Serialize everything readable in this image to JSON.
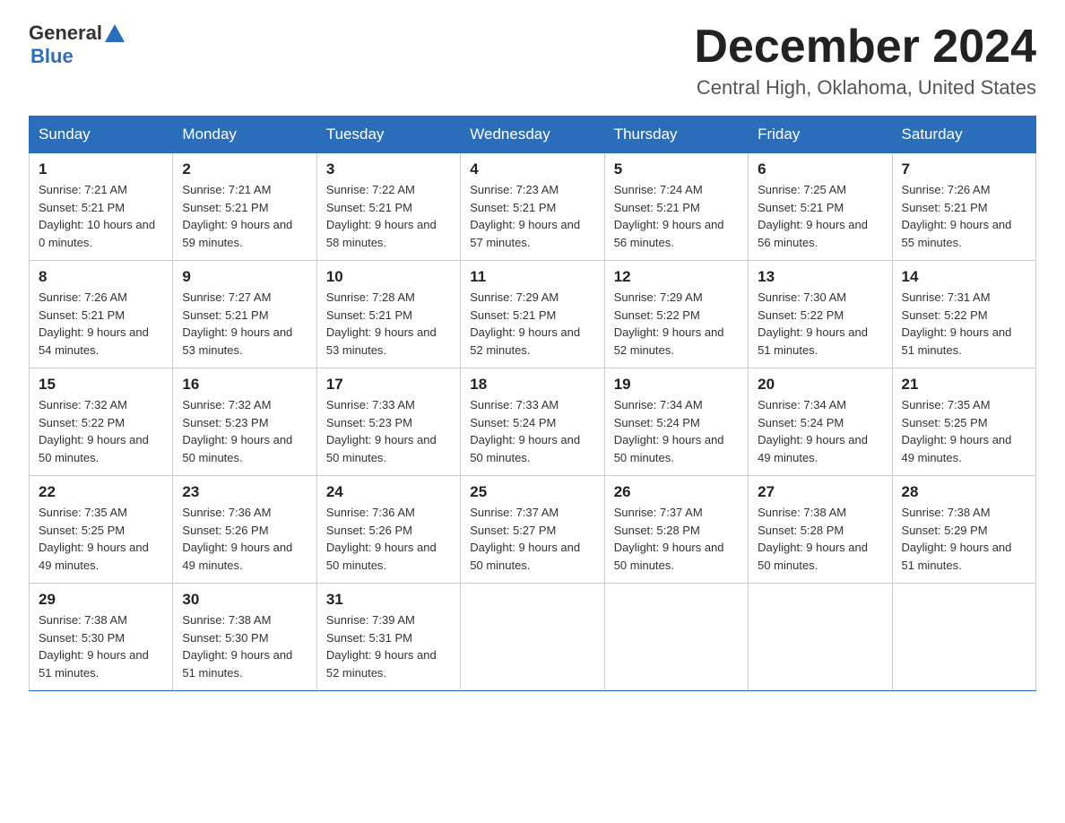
{
  "header": {
    "logo": {
      "general": "General",
      "arrow_symbol": "▲",
      "blue": "Blue"
    },
    "title": "December 2024",
    "location": "Central High, Oklahoma, United States"
  },
  "days_of_week": [
    "Sunday",
    "Monday",
    "Tuesday",
    "Wednesday",
    "Thursday",
    "Friday",
    "Saturday"
  ],
  "weeks": [
    [
      {
        "day": "1",
        "sunrise": "7:21 AM",
        "sunset": "5:21 PM",
        "daylight": "10 hours and 0 minutes."
      },
      {
        "day": "2",
        "sunrise": "7:21 AM",
        "sunset": "5:21 PM",
        "daylight": "9 hours and 59 minutes."
      },
      {
        "day": "3",
        "sunrise": "7:22 AM",
        "sunset": "5:21 PM",
        "daylight": "9 hours and 58 minutes."
      },
      {
        "day": "4",
        "sunrise": "7:23 AM",
        "sunset": "5:21 PM",
        "daylight": "9 hours and 57 minutes."
      },
      {
        "day": "5",
        "sunrise": "7:24 AM",
        "sunset": "5:21 PM",
        "daylight": "9 hours and 56 minutes."
      },
      {
        "day": "6",
        "sunrise": "7:25 AM",
        "sunset": "5:21 PM",
        "daylight": "9 hours and 56 minutes."
      },
      {
        "day": "7",
        "sunrise": "7:26 AM",
        "sunset": "5:21 PM",
        "daylight": "9 hours and 55 minutes."
      }
    ],
    [
      {
        "day": "8",
        "sunrise": "7:26 AM",
        "sunset": "5:21 PM",
        "daylight": "9 hours and 54 minutes."
      },
      {
        "day": "9",
        "sunrise": "7:27 AM",
        "sunset": "5:21 PM",
        "daylight": "9 hours and 53 minutes."
      },
      {
        "day": "10",
        "sunrise": "7:28 AM",
        "sunset": "5:21 PM",
        "daylight": "9 hours and 53 minutes."
      },
      {
        "day": "11",
        "sunrise": "7:29 AM",
        "sunset": "5:21 PM",
        "daylight": "9 hours and 52 minutes."
      },
      {
        "day": "12",
        "sunrise": "7:29 AM",
        "sunset": "5:22 PM",
        "daylight": "9 hours and 52 minutes."
      },
      {
        "day": "13",
        "sunrise": "7:30 AM",
        "sunset": "5:22 PM",
        "daylight": "9 hours and 51 minutes."
      },
      {
        "day": "14",
        "sunrise": "7:31 AM",
        "sunset": "5:22 PM",
        "daylight": "9 hours and 51 minutes."
      }
    ],
    [
      {
        "day": "15",
        "sunrise": "7:32 AM",
        "sunset": "5:22 PM",
        "daylight": "9 hours and 50 minutes."
      },
      {
        "day": "16",
        "sunrise": "7:32 AM",
        "sunset": "5:23 PM",
        "daylight": "9 hours and 50 minutes."
      },
      {
        "day": "17",
        "sunrise": "7:33 AM",
        "sunset": "5:23 PM",
        "daylight": "9 hours and 50 minutes."
      },
      {
        "day": "18",
        "sunrise": "7:33 AM",
        "sunset": "5:24 PM",
        "daylight": "9 hours and 50 minutes."
      },
      {
        "day": "19",
        "sunrise": "7:34 AM",
        "sunset": "5:24 PM",
        "daylight": "9 hours and 50 minutes."
      },
      {
        "day": "20",
        "sunrise": "7:34 AM",
        "sunset": "5:24 PM",
        "daylight": "9 hours and 49 minutes."
      },
      {
        "day": "21",
        "sunrise": "7:35 AM",
        "sunset": "5:25 PM",
        "daylight": "9 hours and 49 minutes."
      }
    ],
    [
      {
        "day": "22",
        "sunrise": "7:35 AM",
        "sunset": "5:25 PM",
        "daylight": "9 hours and 49 minutes."
      },
      {
        "day": "23",
        "sunrise": "7:36 AM",
        "sunset": "5:26 PM",
        "daylight": "9 hours and 49 minutes."
      },
      {
        "day": "24",
        "sunrise": "7:36 AM",
        "sunset": "5:26 PM",
        "daylight": "9 hours and 50 minutes."
      },
      {
        "day": "25",
        "sunrise": "7:37 AM",
        "sunset": "5:27 PM",
        "daylight": "9 hours and 50 minutes."
      },
      {
        "day": "26",
        "sunrise": "7:37 AM",
        "sunset": "5:28 PM",
        "daylight": "9 hours and 50 minutes."
      },
      {
        "day": "27",
        "sunrise": "7:38 AM",
        "sunset": "5:28 PM",
        "daylight": "9 hours and 50 minutes."
      },
      {
        "day": "28",
        "sunrise": "7:38 AM",
        "sunset": "5:29 PM",
        "daylight": "9 hours and 51 minutes."
      }
    ],
    [
      {
        "day": "29",
        "sunrise": "7:38 AM",
        "sunset": "5:30 PM",
        "daylight": "9 hours and 51 minutes."
      },
      {
        "day": "30",
        "sunrise": "7:38 AM",
        "sunset": "5:30 PM",
        "daylight": "9 hours and 51 minutes."
      },
      {
        "day": "31",
        "sunrise": "7:39 AM",
        "sunset": "5:31 PM",
        "daylight": "9 hours and 52 minutes."
      },
      null,
      null,
      null,
      null
    ]
  ]
}
